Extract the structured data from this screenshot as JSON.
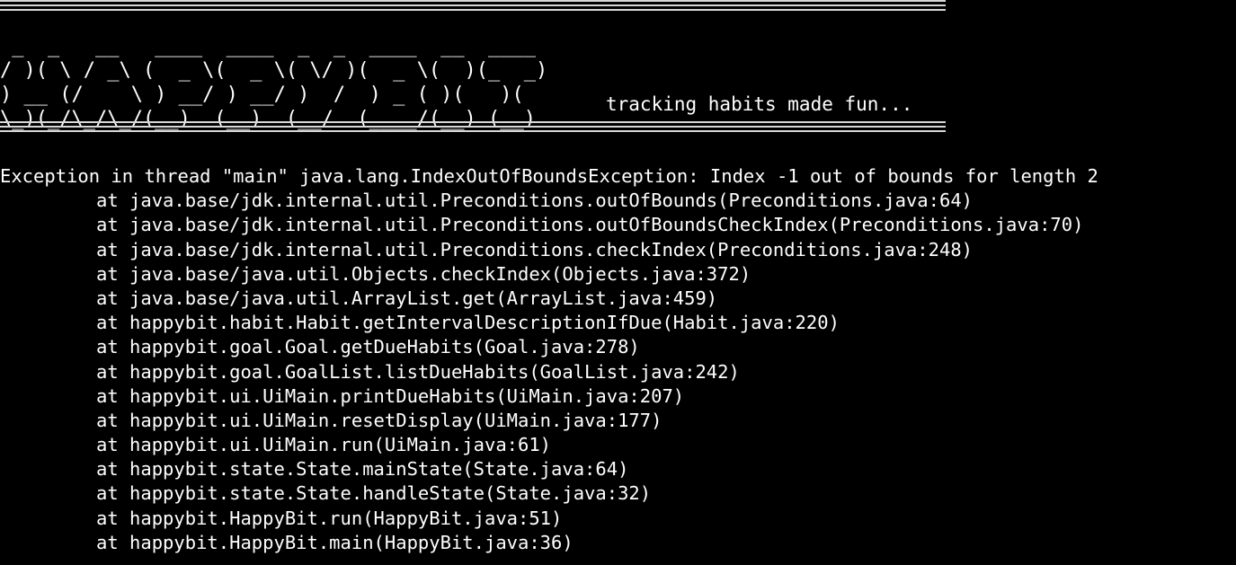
{
  "banner": {
    "ascii_art": " _  _   __   ____  ____  _  _  ____  __  ____ \n/ )( \\ / _\\ (  _ \\(  _ \\( \\/ )(  _ \\(  )(_  _)\n) __ (/    \\ ) __/ ) __/ )  /  ) _ ( )(   )(  \n\\_)(_/\\_/\\_/(__)  (__)  (__/  (____/(__) (__) ",
    "tagline": "tracking habits made fun..."
  },
  "exception": {
    "header": "Exception in thread \"main\" java.lang.IndexOutOfBoundsException: Index -1 out of bounds for length 2",
    "frames": [
      "at java.base/jdk.internal.util.Preconditions.outOfBounds(Preconditions.java:64)",
      "at java.base/jdk.internal.util.Preconditions.outOfBoundsCheckIndex(Preconditions.java:70)",
      "at java.base/jdk.internal.util.Preconditions.checkIndex(Preconditions.java:248)",
      "at java.base/java.util.Objects.checkIndex(Objects.java:372)",
      "at java.base/java.util.ArrayList.get(ArrayList.java:459)",
      "at happybit.habit.Habit.getIntervalDescriptionIfDue(Habit.java:220)",
      "at happybit.goal.Goal.getDueHabits(Goal.java:278)",
      "at happybit.goal.GoalList.listDueHabits(GoalList.java:242)",
      "at happybit.ui.UiMain.printDueHabits(UiMain.java:207)",
      "at happybit.ui.UiMain.resetDisplay(UiMain.java:177)",
      "at happybit.ui.UiMain.run(UiMain.java:61)",
      "at happybit.state.State.mainState(State.java:64)",
      "at happybit.state.State.handleState(State.java:32)",
      "at happybit.HappyBit.run(HappyBit.java:51)",
      "at happybit.HappyBit.main(HappyBit.java:36)"
    ]
  },
  "colors": {
    "background": "#000000",
    "foreground": "#ffffff"
  }
}
